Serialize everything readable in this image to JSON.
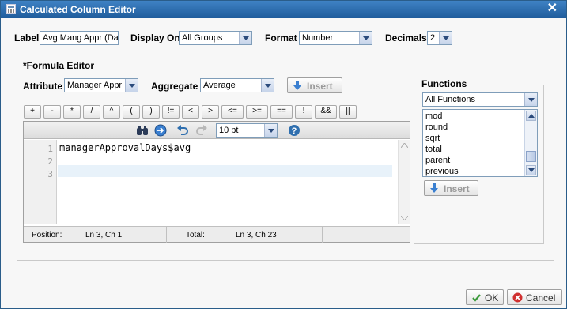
{
  "window": {
    "title": "Calculated Column Editor",
    "close_glyph": "✕"
  },
  "top_fields": {
    "label_label": "Label",
    "label_value": "Avg Mang Appr (Da",
    "display_on_label": "Display On",
    "display_on_value": "All Groups",
    "format_label": "Format",
    "format_value": "Number",
    "decimals_label": "Decimals",
    "decimals_value": "2"
  },
  "formula_editor": {
    "title": "*Formula Editor",
    "attribute_label": "Attribute",
    "attribute_value": "Manager Appr",
    "aggregate_label": "Aggregate",
    "aggregate_value": "Average",
    "insert_label": "Insert",
    "operators": [
      "+",
      "-",
      "*",
      "/",
      "^",
      "(",
      ")",
      "!=",
      "<",
      ">",
      "<=",
      ">=",
      "==",
      "!",
      "&&",
      "||"
    ],
    "font_size_value": "10 pt",
    "line_numbers": [
      "1",
      "2",
      "3"
    ],
    "code_lines": [
      "managerApprovalDays$avg",
      "",
      ""
    ],
    "status": {
      "position_label": "Position:",
      "position_value": "Ln 3, Ch 1",
      "total_label": "Total:",
      "total_value": "Ln 3, Ch 23"
    }
  },
  "functions": {
    "title": "Functions",
    "filter_value": "All Functions",
    "items": [
      "mod",
      "round",
      "sqrt",
      "total",
      "parent",
      "previous"
    ],
    "insert_label": "Insert"
  },
  "footer": {
    "ok_label": "OK",
    "cancel_label": "Cancel"
  },
  "icons": {
    "binoculars": "binoculars-icon",
    "goto": "goto-arrow-icon",
    "undo": "undo-icon",
    "redo": "redo-icon",
    "help": "help-icon"
  },
  "colors": {
    "title_bar": "#2f6faf",
    "insert_arrow": "#3a7fd0",
    "ok_check": "#3a9a3a",
    "cancel_x": "#d03030"
  }
}
